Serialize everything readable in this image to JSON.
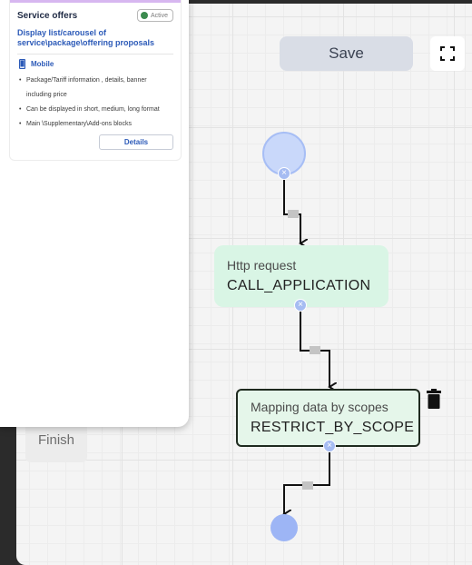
{
  "canvas": {
    "save_label": "Save",
    "finish_label": "Finish",
    "nodes": [
      {
        "type": "Http request",
        "code": "CALL_APPLICATION"
      },
      {
        "type": "Mapping data by scopes",
        "code": "RESTRICT_BY_SCOPE"
      }
    ]
  },
  "offer_card": {
    "title": "Service offers",
    "status": "Active",
    "subtitle": "Display list/carousel of service\\package\\offering proposals",
    "platform": "Mobile",
    "features": [
      "Package/Tariff information , details, banner including price",
      "Can be displayed in short, medium, long format",
      "Main \\Supplementary\\Add-ons blocks"
    ],
    "details_label": "Details"
  },
  "colors": {
    "accent_blue": "#2c5ab8",
    "status_green": "#3c8b4f",
    "node_green": "#d9f5e5",
    "port_blue": "#a6bcf2"
  },
  "icons": [
    "fullscreen-icon",
    "trash-icon",
    "mobile-icon",
    "close-icon"
  ]
}
